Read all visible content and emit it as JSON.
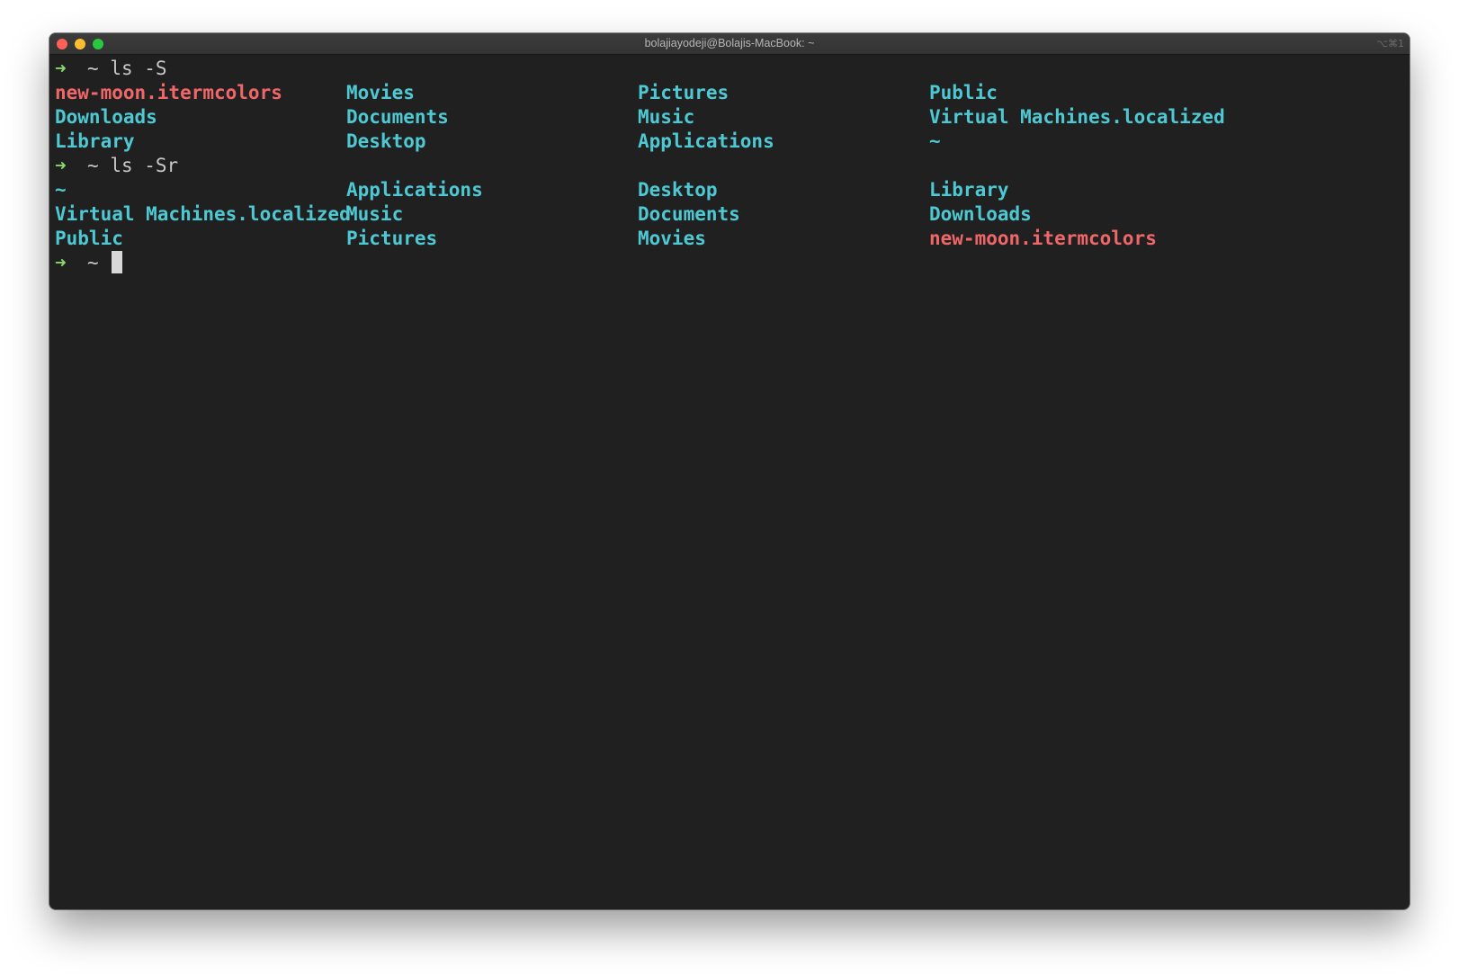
{
  "window": {
    "title": "bolajiayodeji@Bolajis-MacBook: ~",
    "shortcut": "⌥⌘1"
  },
  "prompt": {
    "arrow": "➜",
    "cwd": "~"
  },
  "commands": [
    {
      "text": "ls -S",
      "rows": [
        [
          "new-moon.itermcolors",
          "Movies",
          "Pictures",
          "Public"
        ],
        [
          "Downloads",
          "Documents",
          "Music",
          "Virtual Machines.localized"
        ],
        [
          "Library",
          "Desktop",
          "Applications",
          "~"
        ]
      ]
    },
    {
      "text": "ls -Sr",
      "rows": [
        [
          "~",
          "Applications",
          "Desktop",
          "Library"
        ],
        [
          "Virtual Machines.localized",
          "Music",
          "Documents",
          "Downloads"
        ],
        [
          "Public",
          "Pictures",
          "Movies",
          "new-moon.itermcolors"
        ]
      ]
    }
  ],
  "colors": {
    "background": "#202020",
    "prompt_arrow": "#8bd66b",
    "directory": "#4ec9d3",
    "file": "#f0676a",
    "command": "#c8c8c8"
  }
}
